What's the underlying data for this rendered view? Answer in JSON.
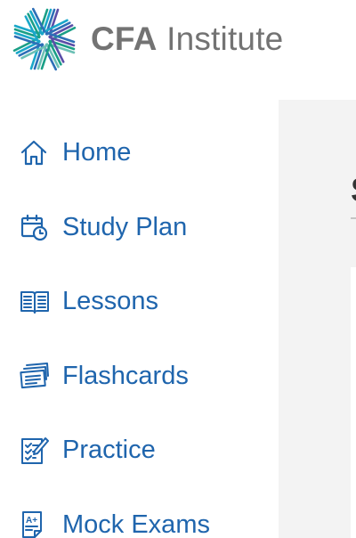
{
  "brand": {
    "name_bold": "CFA",
    "name_rest": " Institute",
    "logo_icon": "cfa-pinwheel-logo"
  },
  "nav": {
    "items": [
      {
        "label": "Home",
        "icon": "home-icon"
      },
      {
        "label": "Study Plan",
        "icon": "calendar-clock-icon"
      },
      {
        "label": "Lessons",
        "icon": "open-book-icon"
      },
      {
        "label": "Flashcards",
        "icon": "flashcards-icon"
      },
      {
        "label": "Practice",
        "icon": "checklist-icon"
      },
      {
        "label": "Mock Exams",
        "icon": "graded-exam-icon"
      }
    ]
  },
  "main": {
    "heading": "S"
  },
  "colors": {
    "nav_text": "#1f65ad",
    "brand_text": "#737373",
    "panel_bg": "#f3f3f3"
  }
}
